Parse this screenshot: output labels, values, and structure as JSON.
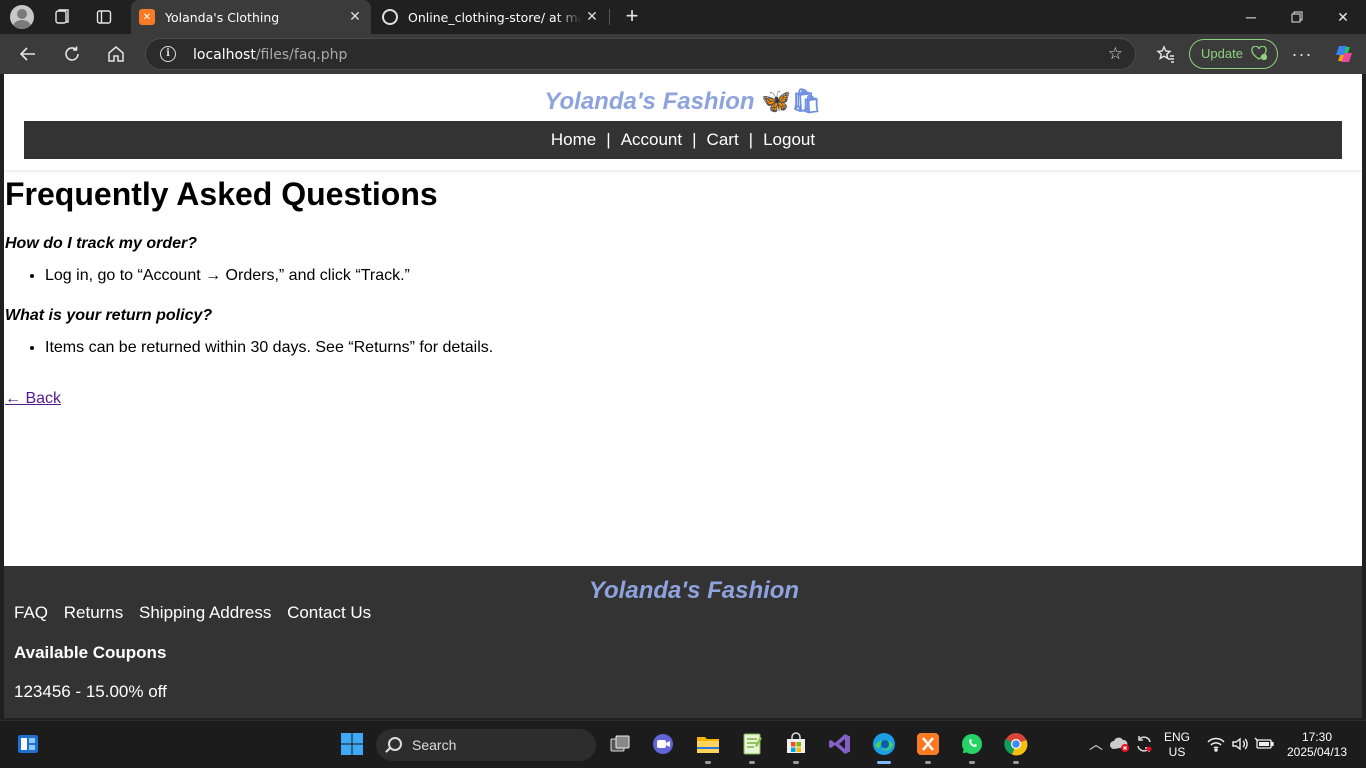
{
  "browser": {
    "tabs": [
      {
        "title": "Yolanda's Clothing",
        "active": true
      },
      {
        "title": "Online_clothing-store/ at main · Y",
        "active": false
      }
    ],
    "address": {
      "host": "localhost",
      "path": "/files/faq.php"
    },
    "update_label": "Update"
  },
  "site": {
    "brand": "Yolanda's Fashion",
    "brand_emoji": "🦋🛍",
    "nav": [
      {
        "label": "Home"
      },
      {
        "label": "Account"
      },
      {
        "label": "Cart"
      },
      {
        "label": "Logout"
      }
    ],
    "nav_separator": "|"
  },
  "page": {
    "title": "Frequently Asked Questions",
    "faqs": [
      {
        "question": "How do I track my order?",
        "answer": "Log in, go to “Account → Orders,” and click “Track.”"
      },
      {
        "question": "What is your return policy?",
        "answer": "Items can be returned within 30 days. See “Returns” for details."
      }
    ],
    "back_label": "← Back"
  },
  "footer": {
    "brand": "Yolanda's Fashion",
    "links": [
      {
        "label": "FAQ"
      },
      {
        "label": "Returns"
      },
      {
        "label": "Shipping Address"
      },
      {
        "label": "Contact Us"
      }
    ],
    "coupons_heading": "Available Coupons",
    "coupon": "123456 - 15.00% off"
  },
  "taskbar": {
    "search_label": "Search",
    "lang": "ENG",
    "region": "US",
    "time": "17:30",
    "date": "2025/04/13",
    "apps": [
      "task-view",
      "teams-meet",
      "file-explorer",
      "notepad-plus",
      "microsoft-store",
      "visual-studio",
      "edge",
      "xampp",
      "whatsapp",
      "chrome"
    ]
  },
  "colors": {
    "brand": "#8ea3dd",
    "navbar_bg": "#333333",
    "footer_bg": "#333333",
    "link_visited": "#551a8b",
    "update_green": "#8fd07d"
  }
}
